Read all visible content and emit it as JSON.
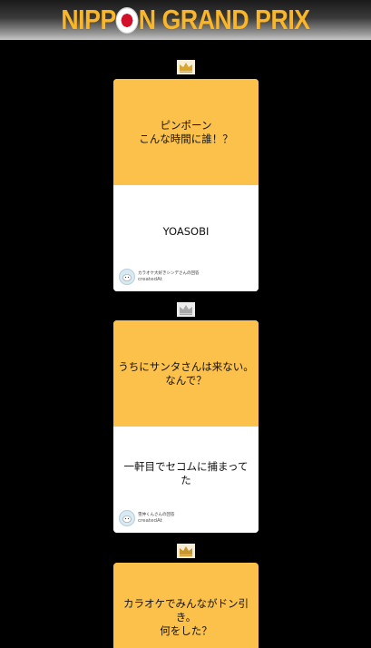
{
  "header": {
    "title_part1": "NIPP",
    "title_part2": "N GRAND PRIX"
  },
  "colors": {
    "background": "#000000",
    "card_top": "#fcc14b",
    "title_gold": "#f8b62b",
    "flag_red": "#d3102a",
    "crown_gold": "#d9a631",
    "crown_silver": "#a8a8a8",
    "crown_bronze": "#c8962e"
  },
  "entries": [
    {
      "rank_icon": "gold-crown-icon",
      "question": "ピンポーン\nこんな時間に誰！？",
      "answer": "YOASOBI",
      "author": "カラオケ大好きシンデさんの回答",
      "created_label": "createdAt"
    },
    {
      "rank_icon": "silver-crown-icon",
      "question": "うちにサンタさんは来ない。\nなんで？",
      "answer": "一軒目でセコムに捕まってた",
      "author": "雪仲くんさんの回答",
      "created_label": "createdAt"
    },
    {
      "rank_icon": "bronze-crown-icon",
      "question": "カラオケでみんながドン引き。\n何をした？",
      "answer": "",
      "author": "",
      "created_label": ""
    }
  ]
}
